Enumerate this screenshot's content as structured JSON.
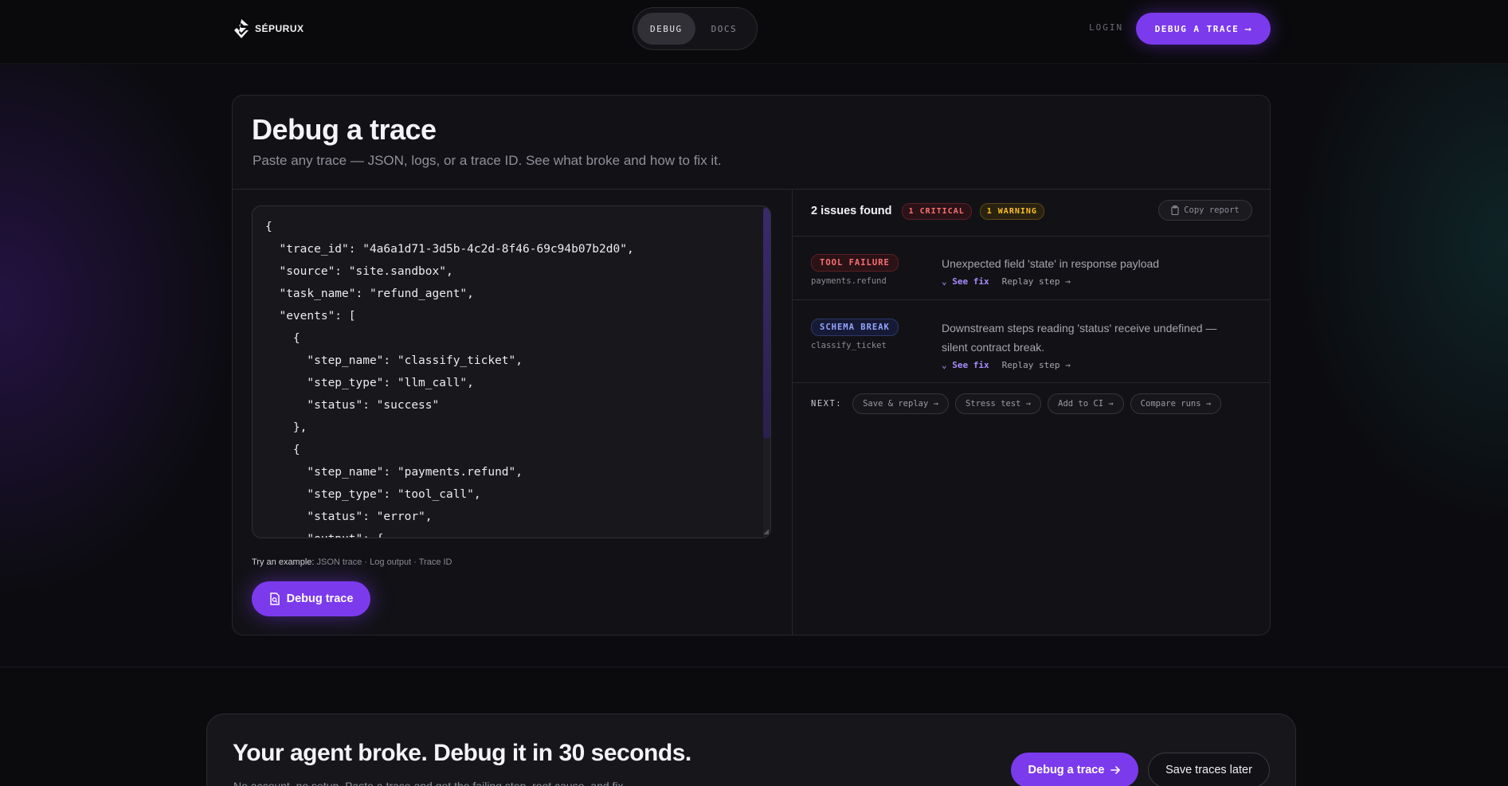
{
  "brand": {
    "name": "SÉPURUX"
  },
  "nav": {
    "tabs": [
      {
        "label": "DEBUG"
      },
      {
        "label": "DOCS"
      }
    ],
    "login": "LOGIN",
    "cta": "DEBUG A TRACE",
    "cta_arrow": "⟶"
  },
  "panel": {
    "title": "Debug a trace",
    "subtitle": "Paste any trace — JSON, logs, or a trace ID. See what broke and how to fix it.",
    "editor_lines": [
      "{",
      "  \"trace_id\": \"4a6a1d71-3d5b-4c2d-8f46-69c94b07b2d0\",",
      "  \"source\": \"site.sandbox\",",
      "  \"task_name\": \"refund_agent\",",
      "  \"events\": [",
      "    {",
      "      \"step_name\": \"classify_ticket\",",
      "      \"step_type\": \"llm_call\",",
      "      \"status\": \"success\"",
      "    },",
      "    {",
      "      \"step_name\": \"payments.refund\",",
      "      \"step_type\": \"tool_call\",",
      "      \"status\": \"error\",",
      "      \"output\": {"
    ],
    "try_label": "Try an example:",
    "examples": "JSON trace · Log output · Trace ID",
    "debug_button": "Debug trace"
  },
  "results": {
    "count": "2 issues found",
    "badges": {
      "critical": "1 CRITICAL",
      "warning": "1 WARNING"
    },
    "copy_report": "Copy report",
    "issues": [
      {
        "type": "TOOL FAILURE",
        "step": "payments.refund",
        "message": "Unexpected field 'state' in response payload",
        "see_fix": "See fix",
        "replay": "Replay step →"
      },
      {
        "type": "SCHEMA BREAK",
        "step": "classify_ticket",
        "message": "Downstream steps reading 'status' receive undefined — silent contract break.",
        "see_fix": "See fix",
        "replay": "Replay step →"
      }
    ],
    "next_label": "NEXT:",
    "next_actions": [
      "Save & replay →",
      "Stress test →",
      "Add to CI →",
      "Compare runs →"
    ]
  },
  "bottom": {
    "title": "Your agent broke. Debug it in 30 seconds.",
    "subtitle": "No account, no setup. Paste a trace and get the failing step, root cause, and fix.",
    "primary": "Debug a trace",
    "secondary": "Save traces later"
  },
  "colors": {
    "accent": "#7c3aed",
    "critical": "#f87171",
    "warning": "#fbbf24",
    "schema": "#93a5ff"
  }
}
